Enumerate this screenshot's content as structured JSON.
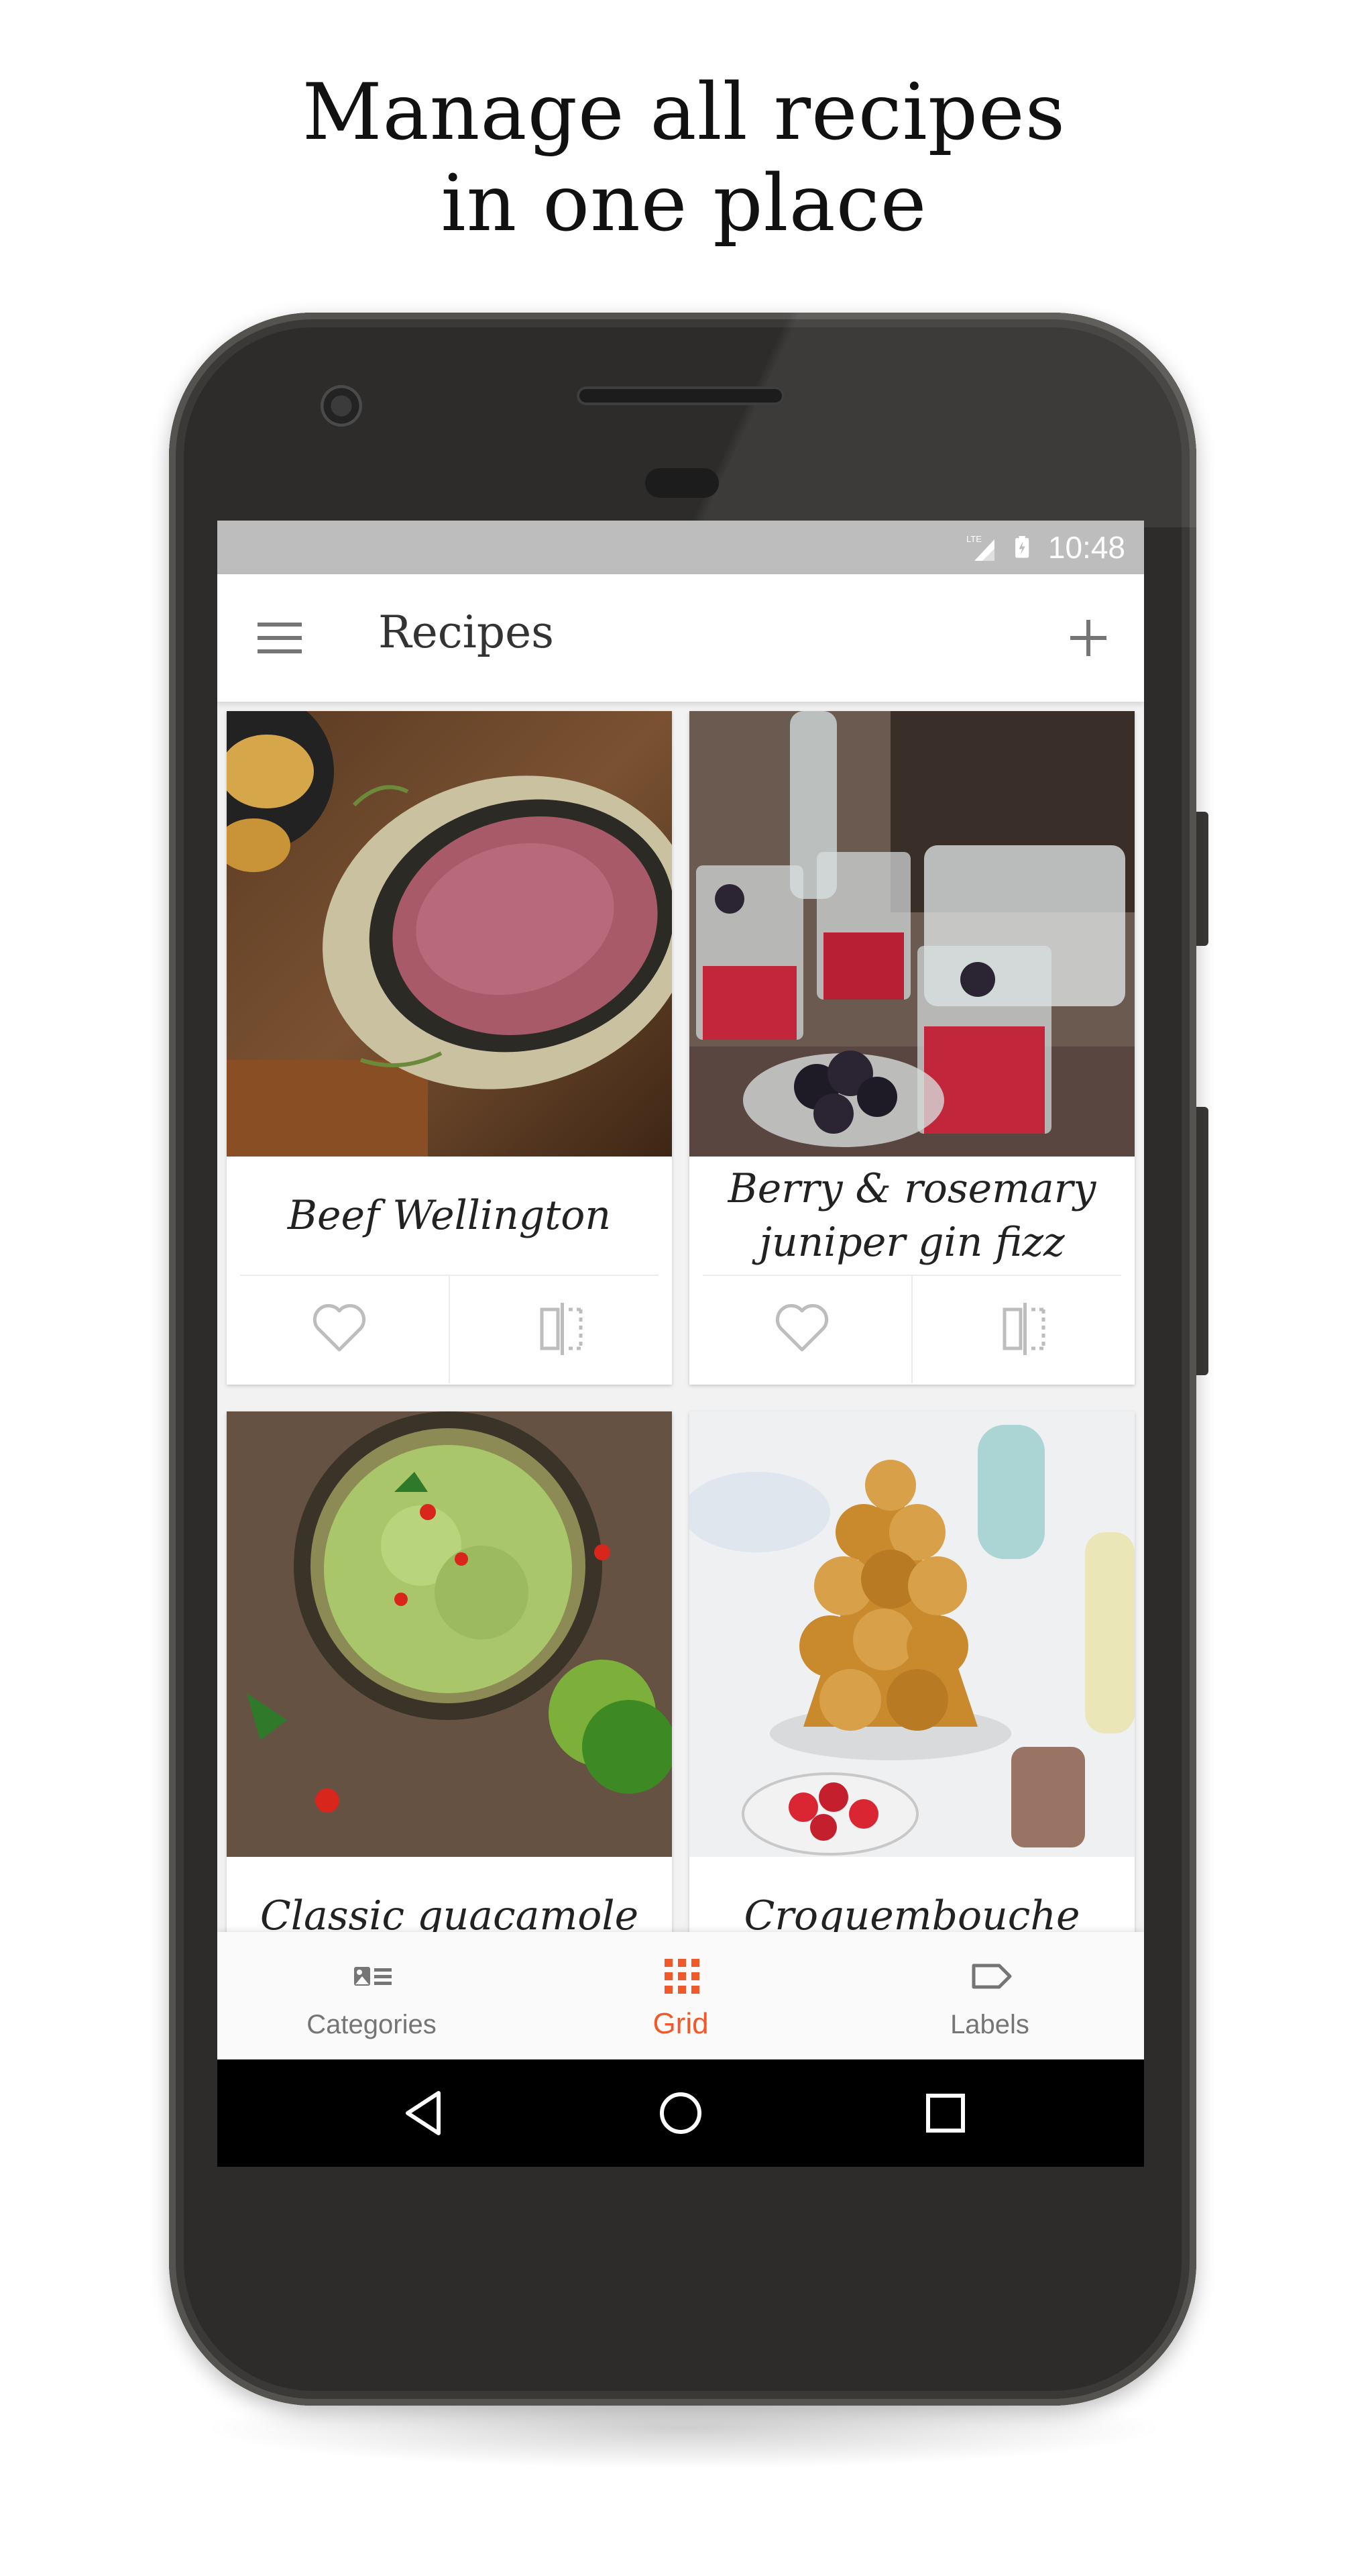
{
  "headline": {
    "line1": "Manage all recipes",
    "line2": "in one place"
  },
  "status_bar": {
    "network": "LTE",
    "time": "10:48"
  },
  "app_bar": {
    "title": "Recipes",
    "menu_icon": "menu-icon",
    "add_icon": "add-icon"
  },
  "recipes": [
    {
      "title": "Beef Wellington",
      "image": "beef-wellington-photo"
    },
    {
      "title": "Berry & rosemary juniper gin fizz",
      "image": "gin-fizz-photo"
    },
    {
      "title": "Classic guacamole",
      "image": "guacamole-photo"
    },
    {
      "title": "Croquembouche",
      "image": "croquembouche-photo"
    }
  ],
  "bottom_nav": {
    "items": [
      {
        "label": "Categories",
        "icon": "categories-icon"
      },
      {
        "label": "Grid",
        "icon": "grid-icon",
        "active": true
      },
      {
        "label": "Labels",
        "icon": "label-icon"
      }
    ]
  },
  "colors": {
    "accent": "#f1592a",
    "status_bar": "#bdbdbd",
    "app_bar": "#ffffff",
    "nav_inactive": "#757575"
  }
}
